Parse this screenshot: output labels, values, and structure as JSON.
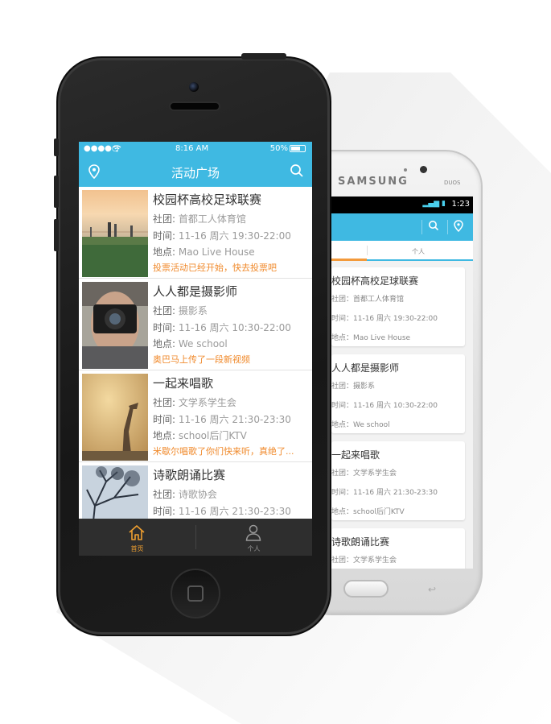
{
  "colors": {
    "accent": "#3fb9e2",
    "highlight": "#f08a2c",
    "tabbar": "#2e2e2e",
    "active_tab": "#f0a030"
  },
  "iphone": {
    "status": {
      "signal": "●●●●○",
      "time": "8:16 AM",
      "battery": "50%"
    },
    "navbar": {
      "title": "活动广场",
      "left_icon": "location-pin-icon",
      "right_icon": "search-icon"
    },
    "items": [
      {
        "title": "校园杯高校足球联赛",
        "club_label": "社团:",
        "club": "首都工人体育馆",
        "time_label": "时间:",
        "time": "11-16  周六 19:30-22:00",
        "place_label": "地点:",
        "place": "Mao Live House",
        "note": "投票活动已经开始，快去投票吧"
      },
      {
        "title": "人人都是摄影师",
        "club_label": "社团:",
        "club": "摄影系",
        "time_label": "时间:",
        "time": "11-16  周六 10:30-22:00",
        "place_label": "地点:",
        "place": "We school",
        "note": "奥巴马上传了一段新视频"
      },
      {
        "title": "一起来唱歌",
        "club_label": "社团:",
        "club": "文学系学生会",
        "time_label": "时间:",
        "time": "11-16  周六 21:30-23:30",
        "place_label": "地点:",
        "place": "school后门KTV",
        "note": "米歇尔唱歌了你们快来听，真绝了..."
      },
      {
        "title": "诗歌朗诵比赛",
        "club_label": "社团:",
        "club": "诗歌协会",
        "time_label": "时间:",
        "time": "11-16  周六 21:30-23:30"
      }
    ],
    "tabbar": {
      "home_label": "首页",
      "home_icon": "home-icon",
      "personal_label": "个人",
      "personal_icon": "person-icon"
    }
  },
  "samsung": {
    "brand": "SAMSUNG",
    "duos": "DUOS",
    "status_time": "1:23",
    "tab_personal": "个人",
    "cards": [
      {
        "title": "校园杯高校足球联赛",
        "club": "社团：首都工人体育馆",
        "time": "时间：11-16  周六 19:30-22:00",
        "place": "地点：Mao Live House"
      },
      {
        "title": "人人都是摄影师",
        "club": "社团：摄影系",
        "time": "时间：11-16  周六 10:30-22:00",
        "place": "地点：We school"
      },
      {
        "title": "一起来唱歌",
        "club": "社团：文学系学生会",
        "time": "时间：11-16  周六 21:30-23:30",
        "place": "地点：school后门KTV"
      },
      {
        "title": "诗歌朗诵比赛",
        "club": "社团：文学系学生会"
      }
    ]
  }
}
